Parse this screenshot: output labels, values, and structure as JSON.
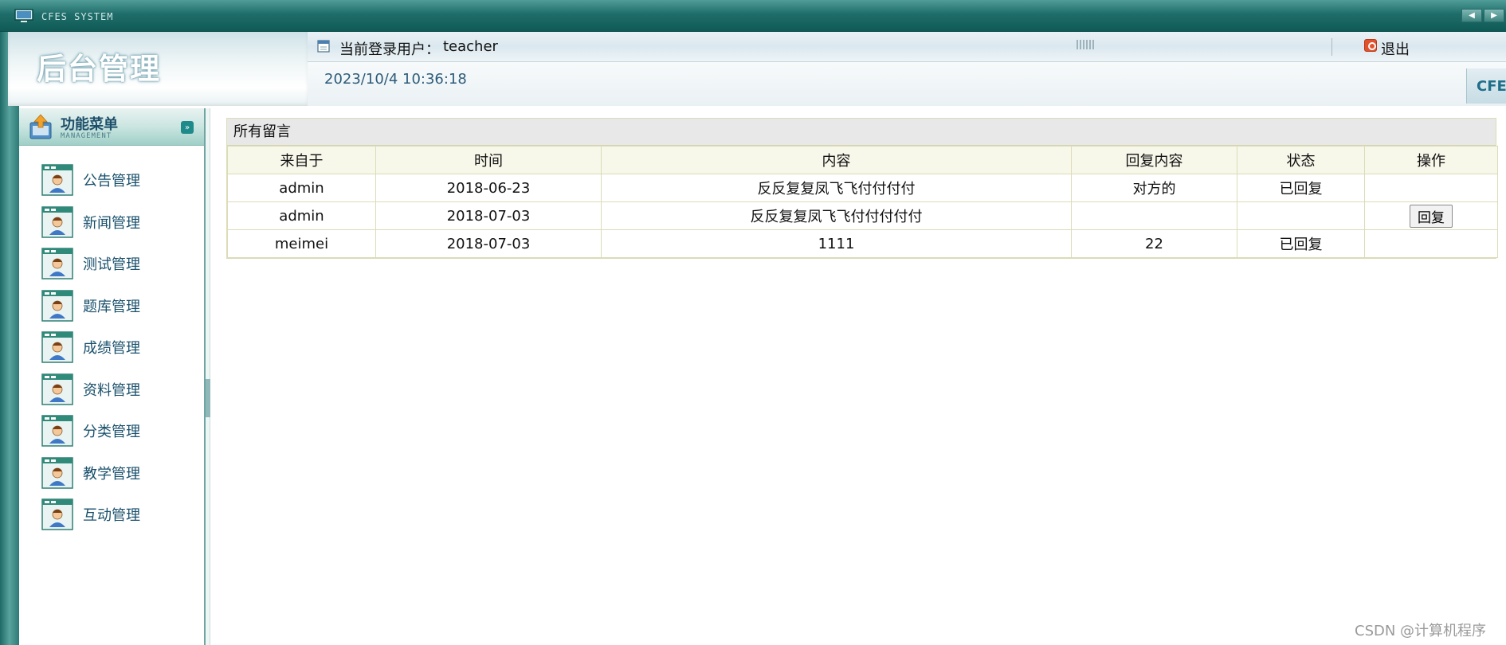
{
  "window": {
    "title": "CFES SYSTEM"
  },
  "header": {
    "brand_title": "后台管理",
    "user_label": "当前登录用户：",
    "user_name": "teacher",
    "logout_label": "退出",
    "datetime": "2023/10/4 10:36:18",
    "corner_logo": "CFES"
  },
  "sidebar": {
    "title": "功能菜单",
    "subtitle": "MANAGEMENT",
    "items": [
      {
        "label": "公告管理"
      },
      {
        "label": "新闻管理"
      },
      {
        "label": "测试管理"
      },
      {
        "label": "题库管理"
      },
      {
        "label": "成绩管理"
      },
      {
        "label": "资料管理"
      },
      {
        "label": "分类管理"
      },
      {
        "label": "教学管理"
      },
      {
        "label": "互动管理"
      }
    ]
  },
  "main": {
    "panel_title": "所有留言",
    "columns": [
      "来自于",
      "时间",
      "内容",
      "回复内容",
      "状态",
      "操作"
    ],
    "rows": [
      {
        "from": "admin",
        "time": "2018-06-23",
        "content": "反反复复凤飞飞付付付付",
        "reply": "对方的",
        "status": "已回复",
        "action": ""
      },
      {
        "from": "admin",
        "time": "2018-07-03",
        "content": "反反复复凤飞飞付付付付付",
        "reply": "",
        "status": "",
        "action": "回复"
      },
      {
        "from": "meimei",
        "time": "2018-07-03",
        "content": "1111",
        "reply": "22",
        "status": "已回复",
        "action": ""
      }
    ]
  },
  "watermark": "CSDN @计算机程序",
  "colors": {
    "teal_frame": "#1f6d6a",
    "menu_text": "#19506c",
    "table_border": "#dcdcb8",
    "header_bg": "#f7f7ea"
  }
}
